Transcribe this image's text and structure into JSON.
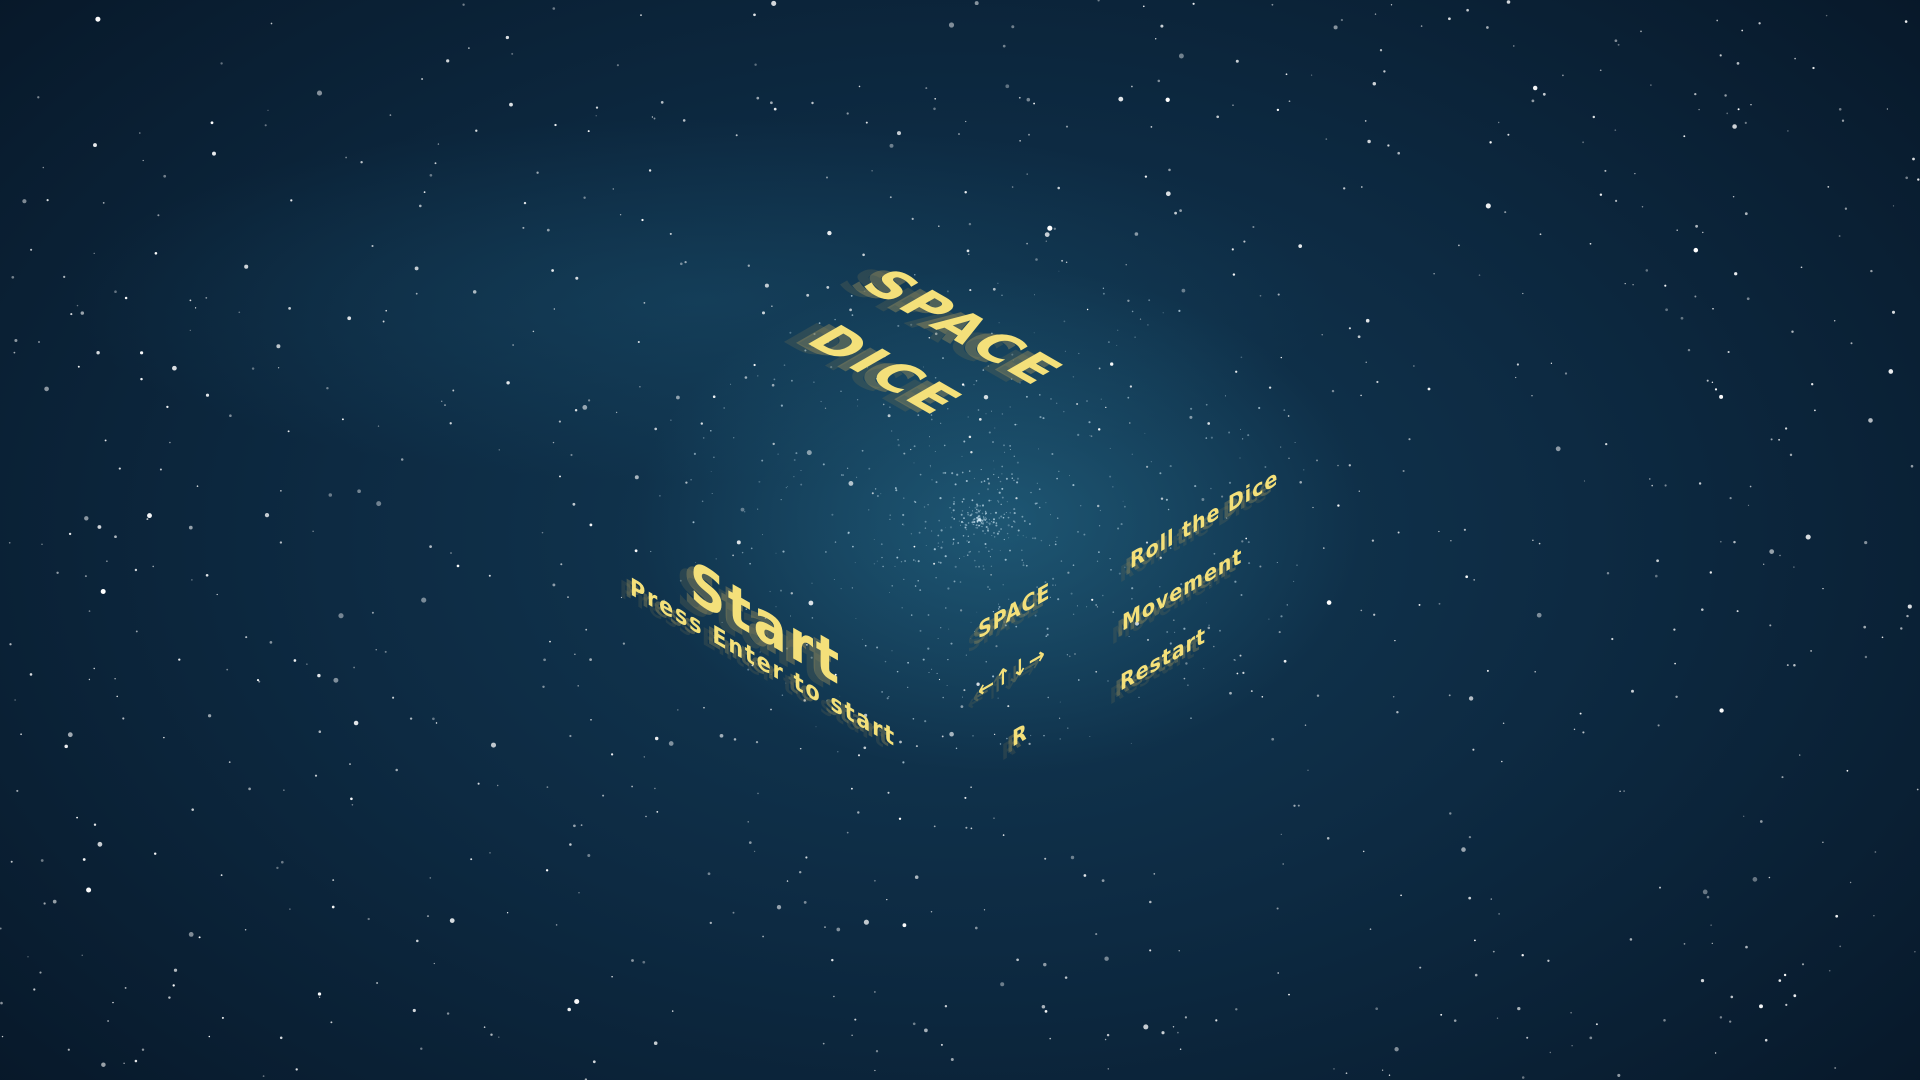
{
  "title": {
    "line1": "SPACE",
    "line2": "DICE"
  },
  "start": {
    "label": "Start",
    "hint": "Press Enter to start"
  },
  "controls": [
    {
      "key": "SPACE",
      "action": "Roll the Dice"
    },
    {
      "key": "←↑↓→",
      "action": "Movement"
    },
    {
      "key": "R",
      "action": "Restart"
    }
  ],
  "colors": {
    "text": "#f4e07a",
    "background": "#0d2a42"
  }
}
